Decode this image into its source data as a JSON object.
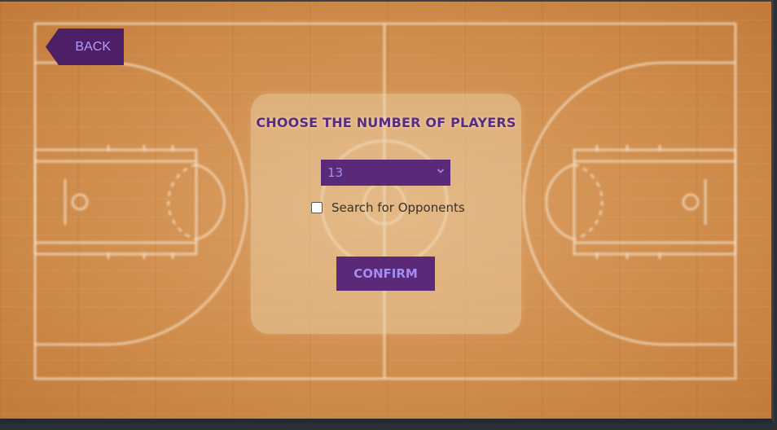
{
  "navigation": {
    "back_label": "BACK"
  },
  "dialog": {
    "title": "CHOOSE THE NUMBER OF PLAYERS",
    "player_count_selected": "13",
    "search_opponents_label": "Search for Opponents",
    "search_opponents_checked": false,
    "confirm_label": "CONFIRM"
  },
  "icons": {
    "select_arrow": "chevron-down-icon"
  },
  "colors": {
    "accent_purple": "#5a2a78",
    "back_purple": "#4d1f67",
    "button_text": "#a58cf0",
    "title_text": "#5a2b80",
    "court_wood": "#d08e4d",
    "court_lines": "#f3dcc0"
  }
}
